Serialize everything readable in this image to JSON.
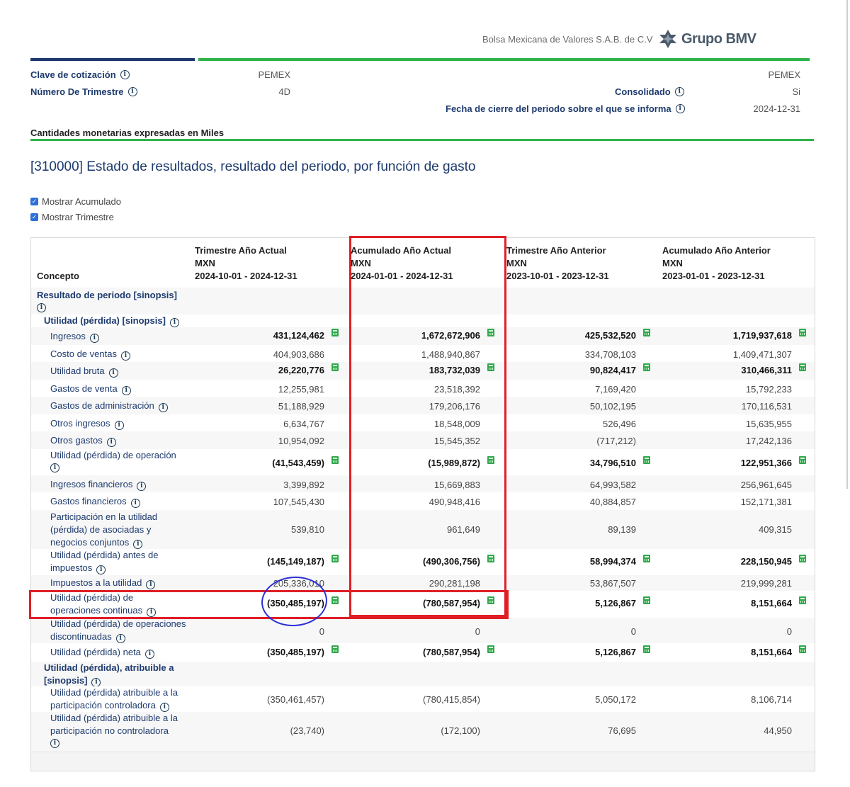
{
  "header": {
    "exchange_name": "Bolsa Mexicana de Valores S.A.B. de C.V",
    "logo_text": "Grupo BMV"
  },
  "meta": {
    "clave_label": "Clave de cotización",
    "clave_value": "PEMEX",
    "trimestre_label": "Número De Trimestre",
    "trimestre_value": "4D",
    "right_clave_value": "PEMEX",
    "consolidado_label": "Consolidado",
    "consolidado_value": "Si",
    "fecha_label": "Fecha de cierre del periodo sobre el que se informa",
    "fecha_value": "2024-12-31",
    "currency_note": "Cantidades monetarias expresadas en Miles"
  },
  "page_title": "[310000] Estado de resultados, resultado del periodo, por función de gasto",
  "options": {
    "mostrar_acumulado": "Mostrar Acumulado",
    "mostrar_trimestre": "Mostrar Trimestre"
  },
  "table": {
    "concept_header": "Concepto",
    "columns": [
      {
        "title": "Trimestre Año Actual",
        "currency": "MXN",
        "period": "2024-10-01 - 2024-12-31"
      },
      {
        "title": "Acumulado Año Actual",
        "currency": "MXN",
        "period": "2024-01-01 - 2024-12-31"
      },
      {
        "title": "Trimestre Año Anterior",
        "currency": "MXN",
        "period": "2023-10-01 - 2023-12-31"
      },
      {
        "title": "Acumulado Año Anterior",
        "currency": "MXN",
        "period": "2023-01-01 - 2023-12-31"
      }
    ],
    "rows": [
      {
        "label": "Resultado de periodo [sinopsis]",
        "values": [
          "",
          "",
          "",
          ""
        ],
        "bold": false,
        "calc": false
      },
      {
        "label": "Utilidad (pérdida) [sinopsis]",
        "values": [
          "",
          "",
          "",
          ""
        ],
        "bold": false,
        "calc": false
      },
      {
        "label": "Ingresos",
        "values": [
          "431,124,462",
          "1,672,672,906",
          "425,532,520",
          "1,719,937,618"
        ],
        "bold": true,
        "calc": true
      },
      {
        "label": "Costo de ventas",
        "values": [
          "404,903,686",
          "1,488,940,867",
          "334,708,103",
          "1,409,471,307"
        ],
        "bold": false,
        "calc": false
      },
      {
        "label": "Utilidad bruta",
        "values": [
          "26,220,776",
          "183,732,039",
          "90,824,417",
          "310,466,311"
        ],
        "bold": true,
        "calc": true
      },
      {
        "label": "Gastos de venta",
        "values": [
          "12,255,981",
          "23,518,392",
          "7,169,420",
          "15,792,233"
        ],
        "bold": false,
        "calc": false
      },
      {
        "label": "Gastos de administración",
        "values": [
          "51,188,929",
          "179,206,176",
          "50,102,195",
          "170,116,531"
        ],
        "bold": false,
        "calc": false
      },
      {
        "label": "Otros ingresos",
        "values": [
          "6,634,767",
          "18,548,009",
          "526,496",
          "15,635,955"
        ],
        "bold": false,
        "calc": false
      },
      {
        "label": "Otros gastos",
        "values": [
          "10,954,092",
          "15,545,352",
          "(717,212)",
          "17,242,136"
        ],
        "bold": false,
        "calc": false
      },
      {
        "label": "Utilidad (pérdida) de operación",
        "values": [
          "(41,543,459)",
          "(15,989,872)",
          "34,796,510",
          "122,951,366"
        ],
        "bold": true,
        "calc": true
      },
      {
        "label": "Ingresos financieros",
        "values": [
          "3,399,892",
          "15,669,883",
          "64,993,582",
          "256,961,645"
        ],
        "bold": false,
        "calc": false
      },
      {
        "label": "Gastos financieros",
        "values": [
          "107,545,430",
          "490,948,416",
          "40,884,857",
          "152,171,381"
        ],
        "bold": false,
        "calc": false
      },
      {
        "label": "Participación en la utilidad (pérdida) de asociadas y negocios conjuntos",
        "values": [
          "539,810",
          "961,649",
          "89,139",
          "409,315"
        ],
        "bold": false,
        "calc": false
      },
      {
        "label": "Utilidad (pérdida) antes de impuestos",
        "values": [
          "(145,149,187)",
          "(490,306,756)",
          "58,994,374",
          "228,150,945"
        ],
        "bold": true,
        "calc": true
      },
      {
        "label": "Impuestos a la utilidad",
        "values": [
          "205,336,010",
          "290,281,198",
          "53,867,507",
          "219,999,281"
        ],
        "bold": false,
        "calc": false
      },
      {
        "label": "Utilidad (pérdida) de operaciones continuas",
        "values": [
          "(350,485,197)",
          "(780,587,954)",
          "5,126,867",
          "8,151,664"
        ],
        "bold": true,
        "calc": true
      },
      {
        "label": "Utilidad (pérdida) de operaciones discontinuadas",
        "values": [
          "0",
          "0",
          "0",
          "0"
        ],
        "bold": false,
        "calc": false
      },
      {
        "label": "Utilidad (pérdida) neta",
        "values": [
          "(350,485,197)",
          "(780,587,954)",
          "5,126,867",
          "8,151,664"
        ],
        "bold": true,
        "calc": true
      },
      {
        "label": "Utilidad (pérdida), atribuible a [sinopsis]",
        "values": [
          "",
          "",
          "",
          ""
        ],
        "bold": false,
        "calc": false
      },
      {
        "label": "Utilidad (pérdida) atribuible a la participación controladora",
        "values": [
          "(350,461,457)",
          "(780,415,854)",
          "5,050,172",
          "8,106,714"
        ],
        "bold": false,
        "calc": false
      },
      {
        "label": "Utilidad (pérdida) atribuible a la participación no controladora",
        "values": [
          "(23,740)",
          "(172,100)",
          "76,695",
          "44,950"
        ],
        "bold": false,
        "calc": false
      }
    ]
  },
  "colors": {
    "annotation_red": "#e01e26",
    "annotation_blue": "#2b2fd6",
    "accent_green": "#2fb34a",
    "navy": "#1d3a6e"
  }
}
